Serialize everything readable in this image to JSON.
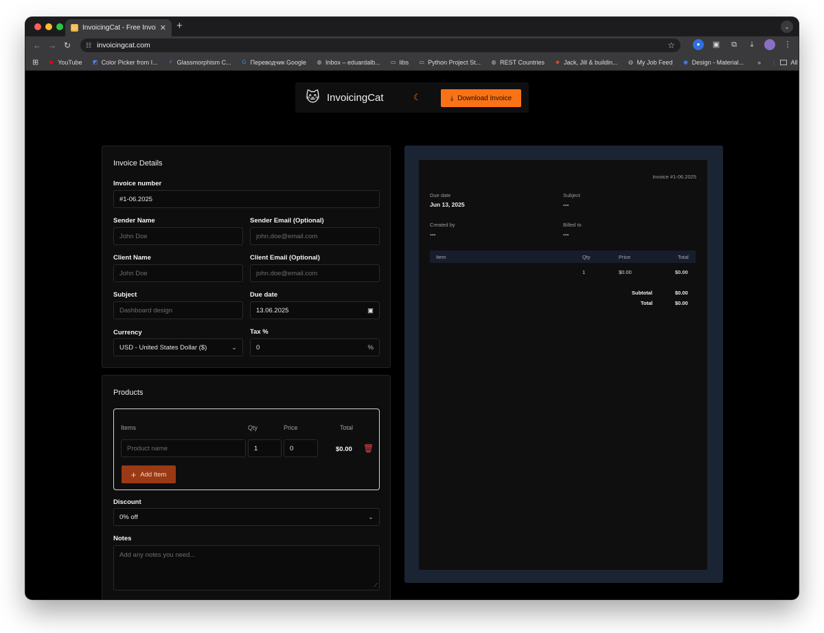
{
  "browser": {
    "tab_title": "InvoicingCat - Free Invoice Ge",
    "tab_close": "✕",
    "new_tab": "+",
    "url": "invoicingcat.com",
    "bookmarks": [
      {
        "label": "YouTube",
        "icon": "youtube-icon",
        "color": "#ff0000"
      },
      {
        "label": "Color Picker from I...",
        "icon": "color-picker-icon",
        "color": "#4a8cf7"
      },
      {
        "label": "Glassmorphism C...",
        "icon": "glassmorphism-icon",
        "color": "#6c7cff"
      },
      {
        "label": "Переводчик Google",
        "icon": "google-translate-icon",
        "color": "#4285f4"
      },
      {
        "label": "Inbox – eduardalb...",
        "icon": "globe-icon",
        "color": "#bdbdbd"
      },
      {
        "label": "libs",
        "icon": "folder-icon",
        "color": "#bdbdbd"
      },
      {
        "label": "Python Project St...",
        "icon": "folder-icon",
        "color": "#bdbdbd"
      },
      {
        "label": "REST Countries",
        "icon": "globe-icon",
        "color": "#bdbdbd"
      },
      {
        "label": "Jack, Jill & buildin...",
        "icon": "person-icon",
        "color": "#c7552c"
      },
      {
        "label": "My Job Feed",
        "icon": "globe-icon",
        "color": "#bdbdbd"
      },
      {
        "label": "Design - Material...",
        "icon": "material-icon",
        "color": "#3d8bfd"
      }
    ],
    "bookmarks_more": "»",
    "all_bookmarks": "All Bookmarks"
  },
  "header": {
    "brand": "InvoicingCat",
    "download_label": "Download Invoice",
    "accent": "#f97316"
  },
  "invoice_details": {
    "title": "Invoice Details",
    "invoice_number_label": "Invoice number",
    "invoice_number": "#1-06.2025",
    "sender_name_label": "Sender Name",
    "sender_name_placeholder": "John Doe",
    "sender_email_label": "Sender Email (Optional)",
    "sender_email_placeholder": "john.doe@email.com",
    "client_name_label": "Client Name",
    "client_name_placeholder": "John Doe",
    "client_email_label": "Client Email (Optional)",
    "client_email_placeholder": "john.doe@email.com",
    "subject_label": "Subject",
    "subject_placeholder": "Dashboard design",
    "due_date_label": "Due date",
    "due_date": "13.06.2025",
    "currency_label": "Currency",
    "currency": "USD - United States Dollar ($)",
    "tax_label": "Tax %",
    "tax": "0",
    "tax_suffix": "%"
  },
  "products": {
    "title": "Products",
    "col_items": "Items",
    "col_qty": "Qty",
    "col_price": "Price",
    "col_total": "Total",
    "item": {
      "name_placeholder": "Product name",
      "qty": "1",
      "price": "0",
      "total": "$0.00"
    },
    "add_item_label": "Add Item",
    "discount_label": "Discount",
    "discount": "0% off",
    "notes_label": "Notes",
    "notes_placeholder": "Add any notes you need..."
  },
  "preview": {
    "invoice_title": "Invoice #1-06.2025",
    "due_date_label": "Due date",
    "due_date": "Jun 13, 2025",
    "subject_label": "Subject",
    "subject": "---",
    "created_by_label": "Created by",
    "created_by": "---",
    "billed_to_label": "Billed to",
    "billed_to": "---",
    "table_headers": {
      "item": "Item",
      "qty": "Qty",
      "price": "Price",
      "total": "Total"
    },
    "row": {
      "qty": "1",
      "price": "$0.00",
      "total": "$0.00"
    },
    "subtotal_label": "Subtotal",
    "subtotal": "$0.00",
    "total_label": "Total",
    "total": "$0.00"
  }
}
